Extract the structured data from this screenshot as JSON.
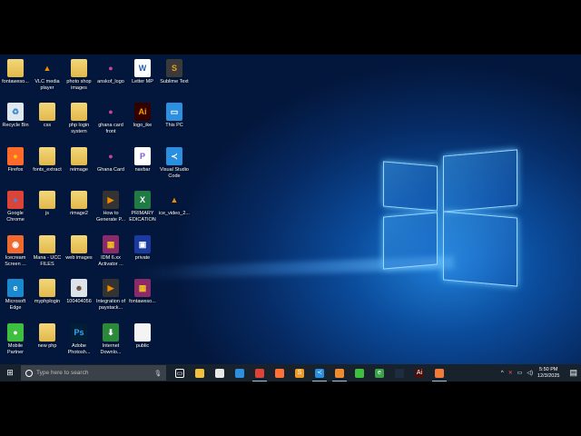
{
  "desktop": {
    "icons": [
      [
        {
          "label": "fontaweso...",
          "type": "folder"
        },
        {
          "label": "VLC media player",
          "type": "vlc"
        },
        {
          "label": "photo shop images",
          "type": "folder"
        },
        {
          "label": "anskof_logo",
          "type": "image"
        },
        {
          "label": "Letter MP",
          "type": "word"
        },
        {
          "label": "Sublime Text",
          "type": "sublime"
        }
      ],
      [
        {
          "label": "Recycle Bin",
          "type": "recycle"
        },
        {
          "label": "css",
          "type": "folder"
        },
        {
          "label": "php login system",
          "type": "folder"
        },
        {
          "label": "ghana card front",
          "type": "image"
        },
        {
          "label": "logo_ike",
          "type": "illustrator"
        },
        {
          "label": "This PC",
          "type": "pc"
        }
      ],
      [
        {
          "label": "Firefox",
          "type": "firefox"
        },
        {
          "label": "fonts_extract",
          "type": "folder"
        },
        {
          "label": "reimage",
          "type": "folder"
        },
        {
          "label": "Ghana Card",
          "type": "image"
        },
        {
          "label": "navbar",
          "type": "php"
        },
        {
          "label": "Visual Studio Code",
          "type": "vscode"
        }
      ],
      [
        {
          "label": "Google Chrome",
          "type": "chrome"
        },
        {
          "label": "js",
          "type": "folder"
        },
        {
          "label": "rimage2",
          "type": "folder"
        },
        {
          "label": "How to Generate P...",
          "type": "video"
        },
        {
          "label": "PRIMARY EDICATION",
          "type": "excel"
        },
        {
          "label": "ice_video_2...",
          "type": "vlc"
        }
      ],
      [
        {
          "label": "Icecream Screen ...",
          "type": "icecream"
        },
        {
          "label": "Mana - UCC FILES",
          "type": "folder"
        },
        {
          "label": "web images",
          "type": "folder"
        },
        {
          "label": "IDM 6.xx Activator ...",
          "type": "rar"
        },
        {
          "label": "private",
          "type": "private"
        }
      ],
      [
        {
          "label": "Microsoft Edge",
          "type": "edge"
        },
        {
          "label": "myphplogin",
          "type": "folder"
        },
        {
          "label": "100404056",
          "type": "photo"
        },
        {
          "label": "Integration of paystack...",
          "type": "video"
        },
        {
          "label": "fontaweso...",
          "type": "rar"
        }
      ],
      [
        {
          "label": "Mobile Partner",
          "type": "mobile"
        },
        {
          "label": "new php",
          "type": "folder"
        },
        {
          "label": "Adobe Photosh...",
          "type": "photoshop"
        },
        {
          "label": "Internet Downlo...",
          "type": "idm"
        },
        {
          "label": "public",
          "type": "file"
        }
      ]
    ]
  },
  "taskbar": {
    "search_placeholder": "Type here to search",
    "apps": [
      {
        "name": "task-view",
        "glyph": "▭",
        "color": "#17222d"
      },
      {
        "name": "file-explorer",
        "glyph": "",
        "color": "#f0c040"
      },
      {
        "name": "microsoft-store",
        "glyph": "",
        "color": "#e8e8e8"
      },
      {
        "name": "app-blue",
        "glyph": "",
        "color": "#2d8fe0"
      },
      {
        "name": "chrome",
        "glyph": "",
        "color": "#db4437",
        "active": true
      },
      {
        "name": "firefox",
        "glyph": "",
        "color": "#ff7139"
      },
      {
        "name": "sublime-text",
        "glyph": "S",
        "color": "#f09a24"
      },
      {
        "name": "vscode",
        "glyph": "≺",
        "color": "#2b8fe0",
        "active": true
      },
      {
        "name": "xampp",
        "glyph": "",
        "color": "#f28a2e",
        "active": true
      },
      {
        "name": "mobile-partner",
        "glyph": "",
        "color": "#3fbf3f"
      },
      {
        "name": "internet-explorer",
        "glyph": "e",
        "color": "#3aa24a"
      },
      {
        "name": "app-dark",
        "glyph": "",
        "color": "#1e2e40"
      },
      {
        "name": "illustrator",
        "glyph": "Ai",
        "color": "#4a0f0f"
      },
      {
        "name": "icecream",
        "glyph": "",
        "color": "#f07a3a",
        "active": true
      }
    ],
    "time": "5:50 PM",
    "date": "12/3/2025"
  }
}
